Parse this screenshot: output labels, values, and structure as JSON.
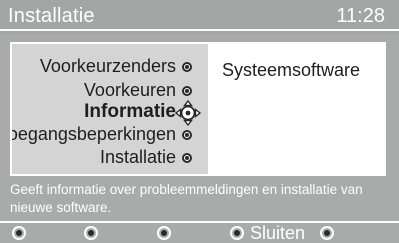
{
  "header": {
    "title": "Installatie",
    "time": "11:28"
  },
  "menu": {
    "items": [
      {
        "label": "Voorkeurzenders",
        "selected": false
      },
      {
        "label": "Voorkeuren",
        "selected": false
      },
      {
        "label": "Informatie",
        "selected": true
      },
      {
        "label": "Toegangsbeperkingen",
        "selected": false
      },
      {
        "label": "Installatie",
        "selected": false
      }
    ]
  },
  "submenu": {
    "items": [
      "Systeemsoftware"
    ]
  },
  "help_text": "Geeft informatie over probleemmeldingen en installatie van nieuwe software.",
  "footer": {
    "keys": [
      {
        "label": ""
      },
      {
        "label": ""
      },
      {
        "label": ""
      },
      {
        "label": "Sluiten"
      },
      {
        "label": ""
      }
    ]
  },
  "colors": {
    "background": "#a9aaaa",
    "menu_panel": "#d4d4d4",
    "text": "#1e1e1e",
    "highlight": "#ffffff"
  },
  "icons": {
    "cursor": "navigation-cross-icon",
    "item_marker": "bullet-icon",
    "softkey": "softkey-circle-icon"
  }
}
